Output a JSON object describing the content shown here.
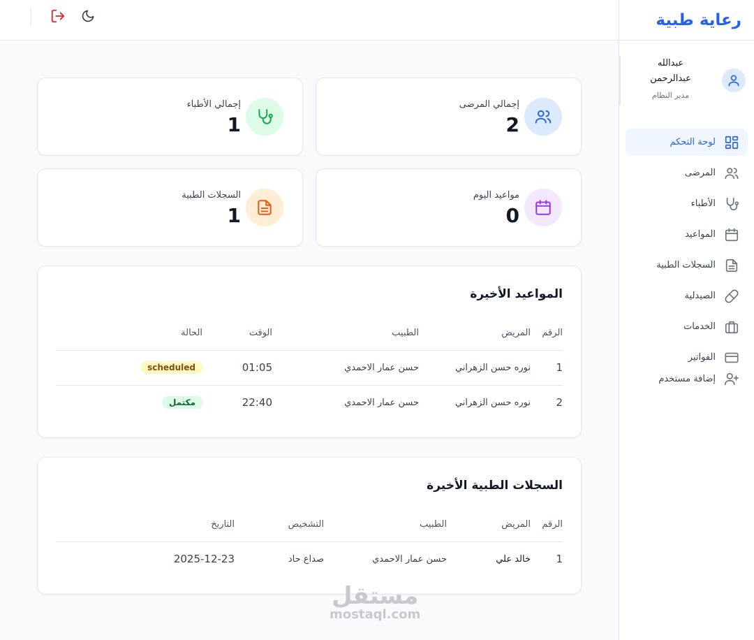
{
  "brand": {
    "title": "رعاية طبية"
  },
  "user": {
    "name_line1": "عبدالله",
    "name_line2": "عبدالرحمن",
    "role": "مدير النظام"
  },
  "nav": [
    {
      "label": "لوحة التحكم",
      "icon": "dashboard-icon",
      "active": true
    },
    {
      "label": "المرضى",
      "icon": "users-icon"
    },
    {
      "label": "الأطباء",
      "icon": "stethoscope-icon"
    },
    {
      "label": "المواعيد",
      "icon": "calendar-icon"
    },
    {
      "label": "السجلات الطبية",
      "icon": "document-icon"
    },
    {
      "label": "الصيدلية",
      "icon": "pill-icon"
    },
    {
      "label": "الخدمات",
      "icon": "briefcase-icon"
    },
    {
      "label": "الفواتير",
      "icon": "credit-card-icon"
    },
    {
      "label": "إضافة مستخدم",
      "icon": "user-plus-icon"
    }
  ],
  "stats": {
    "patients": {
      "label": "إجمالي المرضى",
      "value": "2"
    },
    "doctors": {
      "label": "إجمالي الأطباء",
      "value": "1"
    },
    "appointments_today": {
      "label": "مواعيد اليوم",
      "value": "0"
    },
    "records": {
      "label": "السجلات الطبية",
      "value": "1"
    }
  },
  "recent_appointments": {
    "title": "المواعيد الأخيرة",
    "headers": {
      "id": "الرقم",
      "patient": "المريض",
      "doctor": "الطبيب",
      "time": "الوقت",
      "status": "الحالة"
    },
    "rows": [
      {
        "id": "1",
        "patient": "نوره حسن الزهراني",
        "doctor": "حسن عمار الاحمدي",
        "time": "01:05",
        "status": "scheduled"
      },
      {
        "id": "2",
        "patient": "نوره حسن الزهراني",
        "doctor": "حسن عمار الاحمدي",
        "time": "22:40",
        "status": "مكتمل"
      }
    ]
  },
  "recent_records": {
    "title": "السجلات الطبية الأخيرة",
    "headers": {
      "id": "الرقم",
      "patient": "المريض",
      "doctor": "الطبيب",
      "diagnosis": "التشخيص",
      "date": "التاريخ"
    },
    "rows": [
      {
        "id": "1",
        "patient": "خالد علي",
        "doctor": "حسن عمار الاحمدي",
        "diagnosis": "صداع حاد",
        "date": "2025-12-23"
      }
    ]
  },
  "colors": {
    "accent": "#2563eb",
    "scheduled_bg": "#fef9c3",
    "scheduled_fg": "#854d0e",
    "completed_bg": "#dcfce7",
    "completed_fg": "#166534",
    "logout": "#dc2626"
  },
  "watermark": {
    "line1": "مستقل",
    "line2": "mostaql.com"
  }
}
